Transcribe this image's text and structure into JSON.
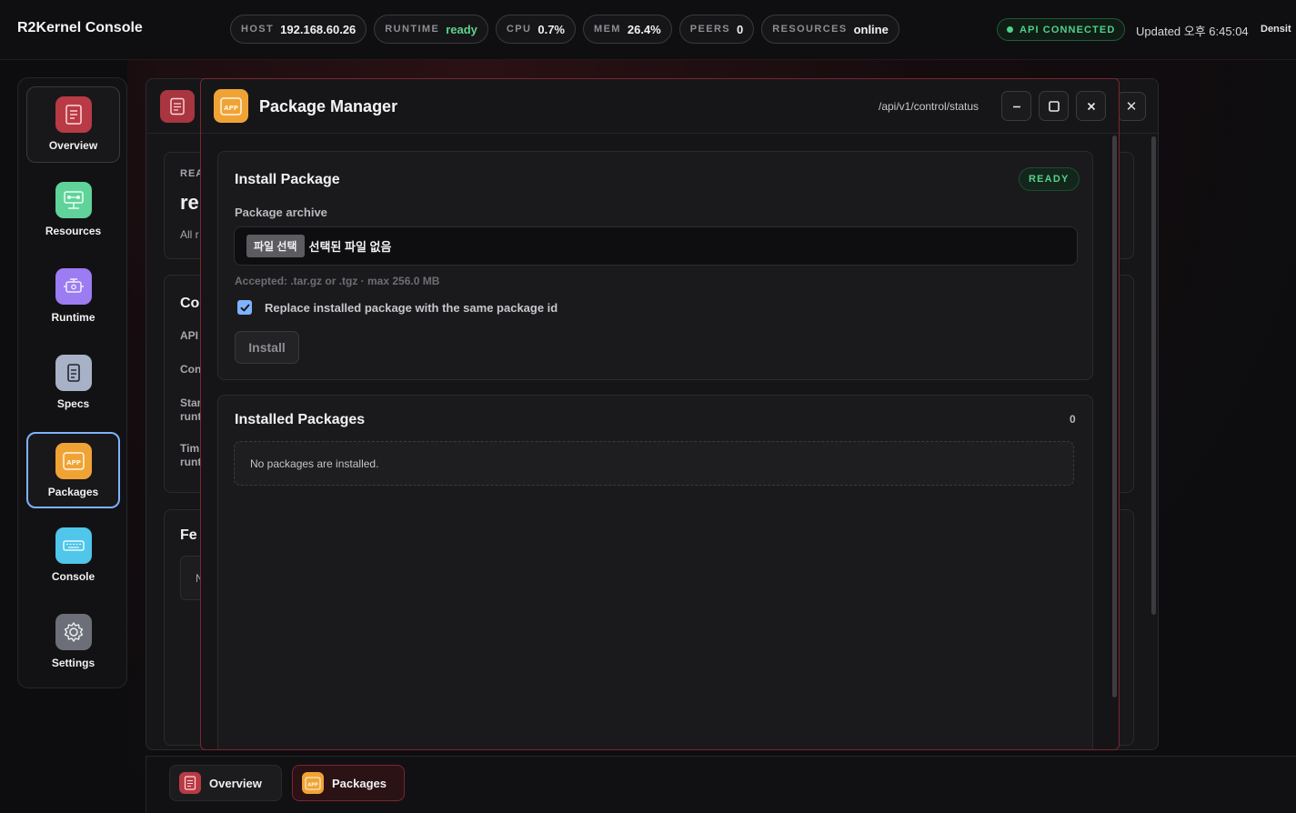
{
  "header": {
    "app_title": "R2Kernel Console",
    "chips": [
      {
        "key": "HOST",
        "value": "192.168.60.26"
      },
      {
        "key": "RUNTIME",
        "value": "ready"
      },
      {
        "key": "CPU",
        "value": "0.7%"
      },
      {
        "key": "MEM",
        "value": "26.4%"
      },
      {
        "key": "PEERS",
        "value": "0"
      },
      {
        "key": "RESOURCES",
        "value": "online"
      }
    ],
    "api_status": "API CONNECTED",
    "updated": "Updated 오후 6:45:04",
    "density": "Densit"
  },
  "sidebar": {
    "items": [
      {
        "label": "Overview",
        "icon": "document-icon",
        "color": "#b83a45"
      },
      {
        "label": "Resources",
        "icon": "network-icon",
        "color": "#5fd39a"
      },
      {
        "label": "Runtime",
        "icon": "engine-icon",
        "color": "#9b7cf2"
      },
      {
        "label": "Specs",
        "icon": "spec-icon",
        "color": "#a7b2c6"
      },
      {
        "label": "Packages",
        "icon": "app-icon",
        "color": "#f0a335"
      },
      {
        "label": "Console",
        "icon": "keyboard-icon",
        "color": "#4fc6ea"
      },
      {
        "label": "Settings",
        "icon": "gear-icon",
        "color": "#6c6f78"
      }
    ]
  },
  "background_window": {
    "fragments": [
      "REA",
      "re",
      "All r",
      "Co",
      "API",
      "Con",
      "Star",
      "runt",
      "Tim",
      "runt",
      "Fe",
      "N"
    ]
  },
  "package_manager": {
    "title": "Package Manager",
    "path": "/api/v1/control/status",
    "install": {
      "title": "Install Package",
      "status": "READY",
      "field_label": "Package archive",
      "file_button": "파일 선택",
      "file_name": "선택된 파일 없음",
      "accepted": "Accepted: .tar.gz or .tgz · max 256.0 MB",
      "replace_label": "Replace installed package with the same package id",
      "replace_checked": true,
      "install_button": "Install"
    },
    "installed": {
      "title": "Installed Packages",
      "count": "0",
      "empty_message": "No packages are installed."
    }
  },
  "taskbar": {
    "items": [
      {
        "label": "Overview",
        "icon": "document-icon"
      },
      {
        "label": "Packages",
        "icon": "app-icon"
      }
    ]
  },
  "colors": {
    "accent_red": "#b83a45",
    "accent_orange": "#f0a335",
    "status_green": "#4ed18a",
    "focus_blue": "#7fb2ff"
  }
}
